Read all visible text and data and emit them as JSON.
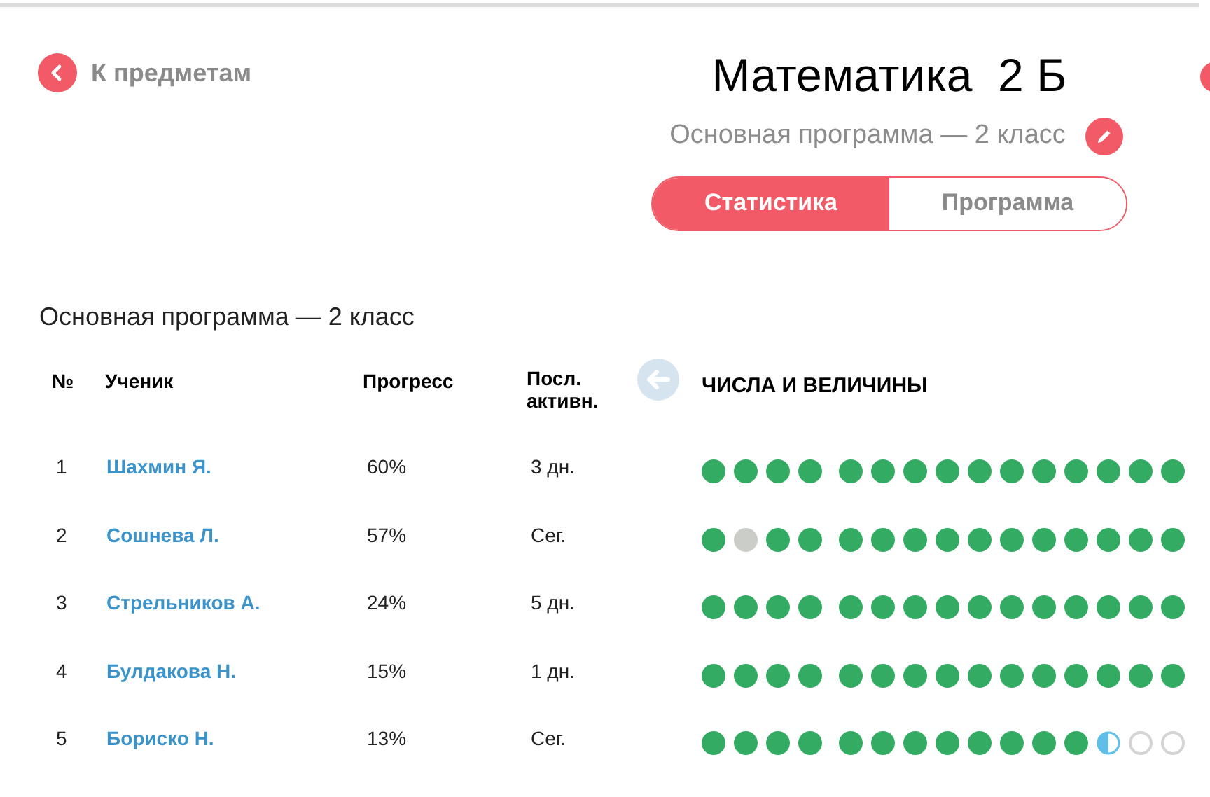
{
  "back_link": "К предметам",
  "title": "Математика  2 Б",
  "subtitle": "Основная программа — 2 класс",
  "tabs": [
    {
      "label": "Статистика",
      "selected": true
    },
    {
      "label": "Программа",
      "selected": false
    }
  ],
  "section_title": "Основная программа — 2 класс",
  "table": {
    "columns": [
      "№",
      "Ученик",
      "Прогресс",
      "Посл. активн."
    ],
    "topic": "ЧИСЛА И ВЕЛИЧИНЫ",
    "rows": [
      {
        "number": "1",
        "name": "Шахмин Я.",
        "progress": "60%",
        "last_active": "3 дн.",
        "groups": [
          {
            "dots": [
              {
                "kind": "done"
              },
              {
                "kind": "done"
              },
              {
                "kind": "done"
              },
              {
                "kind": "done"
              }
            ]
          },
          {
            "dots": [
              {
                "kind": "done"
              },
              {
                "kind": "done"
              },
              {
                "kind": "done"
              },
              {
                "kind": "done"
              },
              {
                "kind": "done"
              },
              {
                "kind": "done"
              },
              {
                "kind": "done"
              },
              {
                "kind": "done"
              },
              {
                "kind": "done"
              },
              {
                "kind": "done"
              },
              {
                "kind": "done"
              }
            ]
          }
        ]
      },
      {
        "number": "2",
        "name": "Сошнева Л.",
        "progress": "57%",
        "last_active": "Сег.",
        "groups": [
          {
            "dots": [
              {
                "kind": "done"
              },
              {
                "kind": "missed"
              },
              {
                "kind": "done"
              },
              {
                "kind": "done"
              }
            ]
          },
          {
            "dots": [
              {
                "kind": "done"
              },
              {
                "kind": "done"
              },
              {
                "kind": "done"
              },
              {
                "kind": "done"
              },
              {
                "kind": "done"
              },
              {
                "kind": "done"
              },
              {
                "kind": "done"
              },
              {
                "kind": "done"
              },
              {
                "kind": "done"
              },
              {
                "kind": "done"
              },
              {
                "kind": "done"
              }
            ]
          }
        ]
      },
      {
        "number": "3",
        "name": "Стрельников А.",
        "progress": "24%",
        "last_active": "5 дн.",
        "groups": [
          {
            "dots": [
              {
                "kind": "done"
              },
              {
                "kind": "done"
              },
              {
                "kind": "done"
              },
              {
                "kind": "done"
              }
            ]
          },
          {
            "dots": [
              {
                "kind": "done"
              },
              {
                "kind": "done"
              },
              {
                "kind": "done"
              },
              {
                "kind": "done"
              },
              {
                "kind": "done"
              },
              {
                "kind": "done"
              },
              {
                "kind": "done"
              },
              {
                "kind": "done"
              },
              {
                "kind": "done"
              },
              {
                "kind": "done"
              },
              {
                "kind": "done"
              }
            ]
          }
        ]
      },
      {
        "number": "4",
        "name": "Булдакова Н.",
        "progress": "15%",
        "last_active": "1 дн.",
        "groups": [
          {
            "dots": [
              {
                "kind": "done"
              },
              {
                "kind": "done"
              },
              {
                "kind": "done"
              },
              {
                "kind": "done"
              }
            ]
          },
          {
            "dots": [
              {
                "kind": "done"
              },
              {
                "kind": "done"
              },
              {
                "kind": "done"
              },
              {
                "kind": "done"
              },
              {
                "kind": "done"
              },
              {
                "kind": "done"
              },
              {
                "kind": "done"
              },
              {
                "kind": "done"
              },
              {
                "kind": "done"
              },
              {
                "kind": "done"
              },
              {
                "kind": "done"
              }
            ]
          }
        ]
      },
      {
        "number": "5",
        "name": "Бориско Н.",
        "progress": "13%",
        "last_active": "Сег.",
        "groups": [
          {
            "dots": [
              {
                "kind": "done"
              },
              {
                "kind": "done"
              },
              {
                "kind": "done"
              },
              {
                "kind": "done"
              }
            ]
          },
          {
            "dots": [
              {
                "kind": "done"
              },
              {
                "kind": "done"
              },
              {
                "kind": "done"
              },
              {
                "kind": "done"
              },
              {
                "kind": "done"
              },
              {
                "kind": "done"
              },
              {
                "kind": "done"
              },
              {
                "kind": "done"
              },
              {
                "kind": "half"
              },
              {
                "kind": "empty"
              },
              {
                "kind": "empty"
              }
            ]
          }
        ]
      }
    ]
  }
}
